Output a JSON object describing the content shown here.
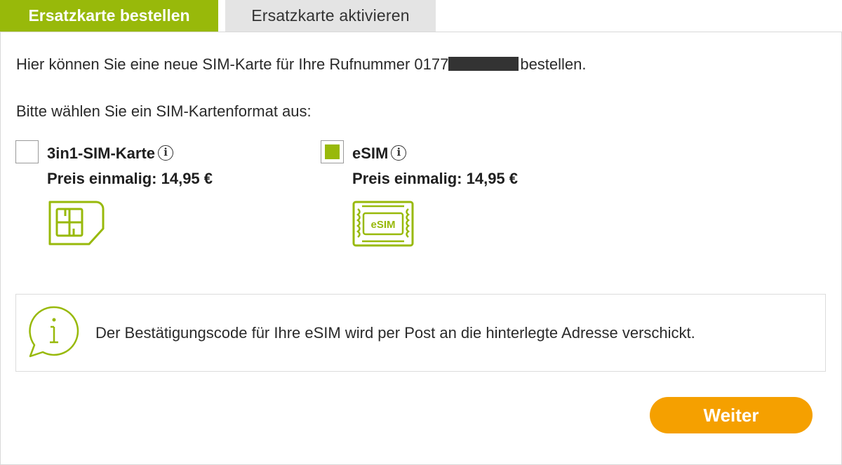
{
  "tabs": [
    {
      "label": "Ersatzkarte bestellen",
      "active": true
    },
    {
      "label": "Ersatzkarte aktivieren",
      "active": false
    }
  ],
  "intro": {
    "before": "Hier können Sie eine neue SIM-Karte für Ihre Rufnummer 0177",
    "after": "bestellen."
  },
  "prompt": "Bitte wählen Sie ein SIM-Kartenformat aus:",
  "options": [
    {
      "name": "3in1-SIM-Karte",
      "price": "Preis einmalig: 14,95 €",
      "checked": false,
      "icon": "sim-card-icon"
    },
    {
      "name": "eSIM",
      "price": "Preis einmalig: 14,95 €",
      "checked": true,
      "icon": "esim-icon",
      "icon_text": "eSIM"
    }
  ],
  "notice": {
    "icon": "info-bubble-icon",
    "text": "Der Bestätigungscode für Ihre eSIM wird per Post an die hinterlegte Adresse verschickt."
  },
  "button": {
    "label": "Weiter"
  },
  "colors": {
    "accent": "#98b90a",
    "button": "#f5a000",
    "tab_inactive": "#e4e4e4"
  }
}
